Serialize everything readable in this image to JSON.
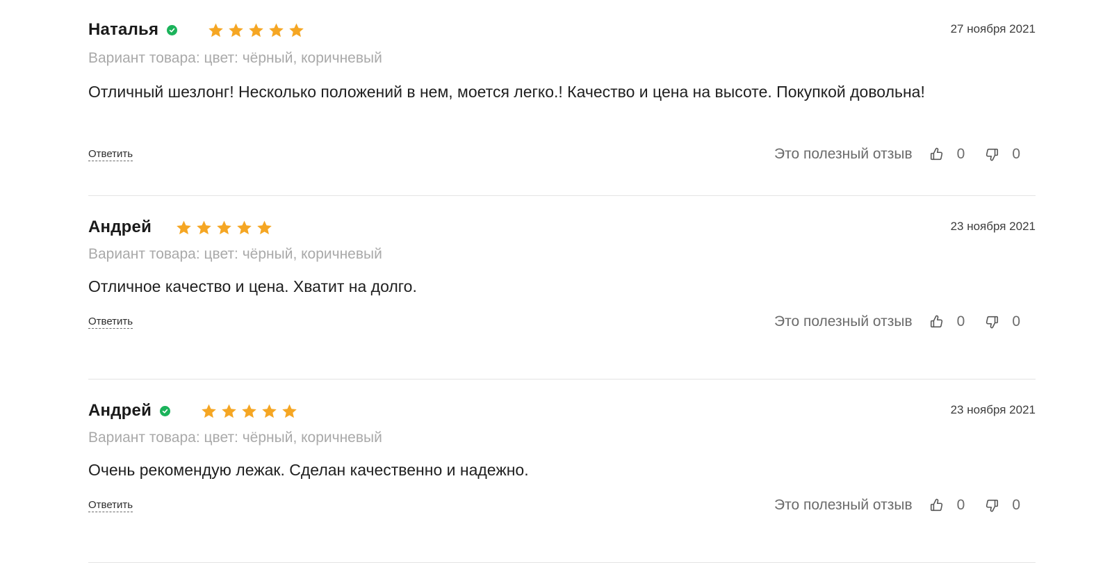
{
  "colors": {
    "star": "#f5a623",
    "verified": "#1bb35b",
    "variant_text": "#a9a9a9",
    "divider": "#e3e3e3"
  },
  "reviews": [
    {
      "author": "Наталья",
      "verified": true,
      "rating": 5,
      "date": "27 ноября 2021",
      "variant": "Вариант товара: цвет: чёрный, коричневый",
      "text": "Отличный шезлонг! Несколько положений в нем, моется легко.! Качество и цена на высоте. Покупкой довольна!",
      "reply_label": "Ответить",
      "helpful_label": "Это полезный отзыв",
      "likes": "0",
      "dislikes": "0"
    },
    {
      "author": "Андрей",
      "verified": false,
      "rating": 5,
      "date": "23 ноября 2021",
      "variant": "Вариант товара: цвет: чёрный, коричневый",
      "text": "Отличное качество и цена. Хватит на долго.",
      "reply_label": "Ответить",
      "helpful_label": "Это полезный отзыв",
      "likes": "0",
      "dislikes": "0"
    },
    {
      "author": "Андрей",
      "verified": true,
      "rating": 5,
      "date": "23 ноября 2021",
      "variant": "Вариант товара: цвет: чёрный, коричневый",
      "text": "Очень рекомендую лежак. Сделан качественно и надежно.",
      "reply_label": "Ответить",
      "helpful_label": "Это полезный отзыв",
      "likes": "0",
      "dislikes": "0"
    }
  ]
}
